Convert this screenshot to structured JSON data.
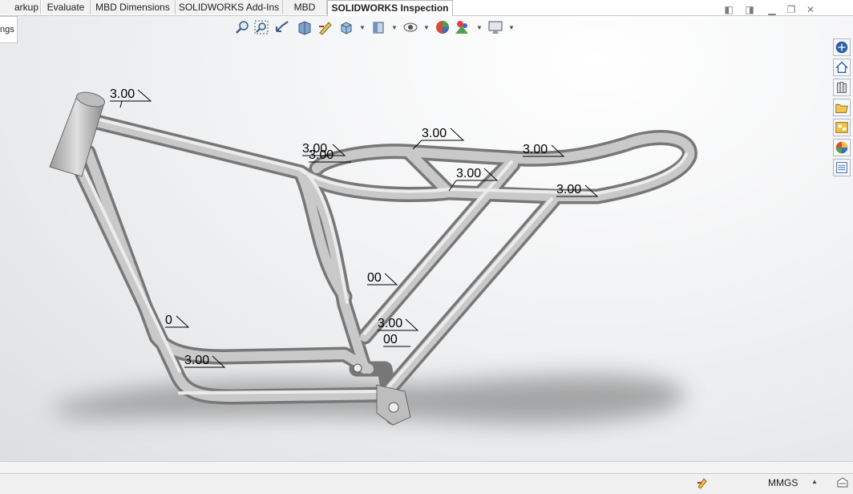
{
  "tabs": [
    {
      "label": "arkup"
    },
    {
      "label": "Evaluate"
    },
    {
      "label": "MBD Dimensions"
    },
    {
      "label": "SOLIDWORKS Add-Ins"
    },
    {
      "label": "MBD"
    },
    {
      "label": "SOLIDWORKS Inspection",
      "active": true
    }
  ],
  "feature_manager": {
    "stub_label": "ngs"
  },
  "headsup_toolbar": [
    "zoom-to-fit-icon",
    "zoom-to-area-icon",
    "previous-view-icon",
    "section-view-icon",
    "dynamic-annotation-icon",
    "view-orientation-icon",
    "display-style-icon",
    "hide-show-items-icon",
    "edit-appearance-icon",
    "apply-scene-icon",
    "view-settings-icon"
  ],
  "task_pane": [
    "solidworks-resources-icon",
    "home-icon",
    "design-library-icon",
    "file-explorer-icon",
    "view-palette-icon",
    "appearances-icon",
    "custom-properties-icon"
  ],
  "annotations": {
    "labels": [
      "3.00",
      "3.00",
      "3.00",
      "3.00",
      "3.00",
      "3.00",
      "3.00",
      "00",
      "3.00",
      "00",
      "0",
      "3.00"
    ]
  },
  "status_bar": {
    "units": "MMGS"
  },
  "colors": {
    "tube_light": "#d2d2d2",
    "tube_dark": "#7e7e7e",
    "active_tab_bg": "#ffffff",
    "viewport_bg": "#eef0f2"
  }
}
